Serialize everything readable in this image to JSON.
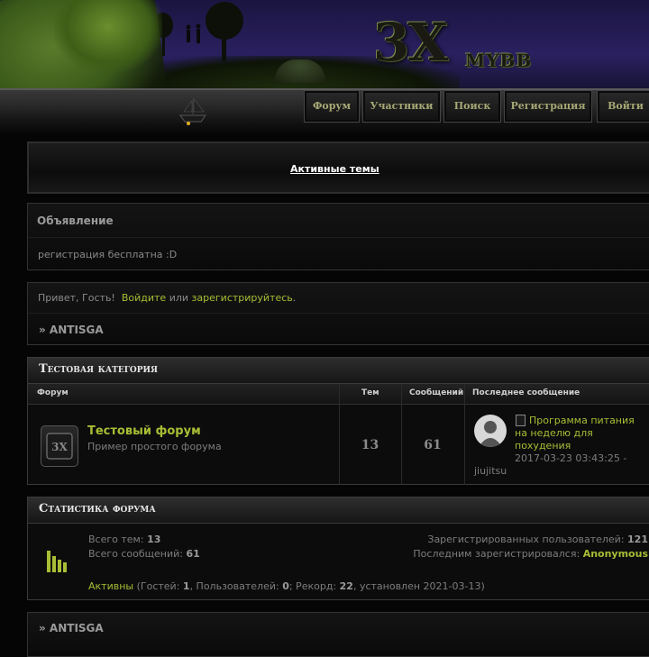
{
  "logo": {
    "main": "3X",
    "sub": "MYBB"
  },
  "nav": [
    {
      "label": "Форум"
    },
    {
      "label": "Участники"
    },
    {
      "label": "Поиск"
    },
    {
      "label": "Регистрация"
    },
    {
      "label": "Войти"
    }
  ],
  "active_topics": "Активные темы",
  "announcement": {
    "title": "Объявление",
    "text": "регистрация бесплатна :D"
  },
  "welcome": {
    "greeting": "Привет, Гость!",
    "login_link": "Войдите",
    "or": "или",
    "register_link": "зарегистрируйтесь",
    "end": "."
  },
  "breadcrumb": "» ANTISGA",
  "category": {
    "title": "Тестовая категория",
    "columns": {
      "forum": "Форум",
      "topics": "Тем",
      "posts": "Сообщений",
      "last": "Последнее сообщение"
    },
    "forum": {
      "name": "Тестовый форум",
      "description": "Пример простого форума",
      "topics": "13",
      "posts": "61",
      "last_post": {
        "title": "Программа питания на неделю для похудения",
        "date": "2017-03-23 03:43:25 -",
        "user": "jiujitsu"
      }
    }
  },
  "stats": {
    "title": "Статистика форума",
    "topics_label": "Всего тем:",
    "topics": "13",
    "posts_label": "Всего сообщений:",
    "posts": "61",
    "users_label": "Зарегистрированных пользователей:",
    "users": "121",
    "last_reg_label": "Последним зарегистрировался:",
    "last_reg": "Anonymous",
    "online_link": "Активны",
    "online_open": " (Гостей: ",
    "guests": "1",
    "online_users_label": ", Пользователей: ",
    "online_users": "0",
    "record_label": "; Рекорд: ",
    "record": "22",
    "record_date": ", установлен 2021-03-13)"
  },
  "colors": {
    "accent": "#a9bd35",
    "nav_text": "#a6a875"
  }
}
